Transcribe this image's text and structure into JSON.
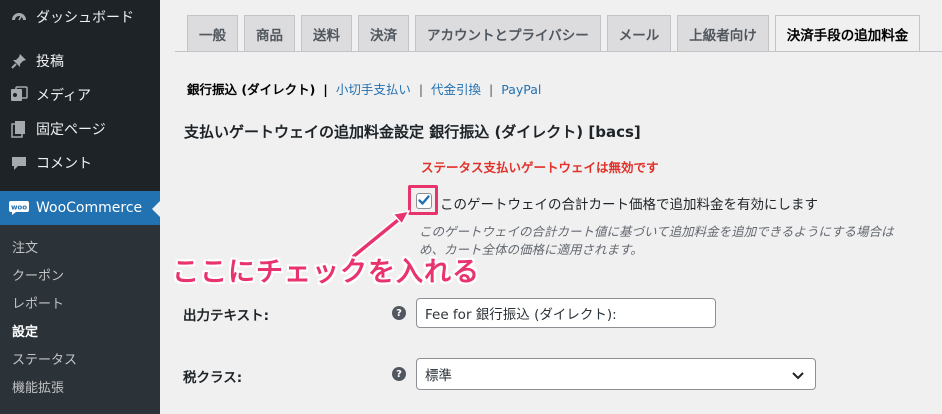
{
  "sidebar": {
    "items": [
      {
        "label": "ダッシュボード",
        "icon": "dashboard-icon"
      },
      {
        "label": "投稿",
        "icon": "pin-icon"
      },
      {
        "label": "メディア",
        "icon": "media-icon"
      },
      {
        "label": "固定ページ",
        "icon": "page-icon"
      },
      {
        "label": "コメント",
        "icon": "comment-icon"
      },
      {
        "label": "WooCommerce",
        "icon": "woo-icon"
      }
    ],
    "submenu": [
      {
        "label": "注文"
      },
      {
        "label": "クーポン"
      },
      {
        "label": "レポート"
      },
      {
        "label": "設定"
      },
      {
        "label": "ステータス"
      },
      {
        "label": "機能拡張"
      }
    ]
  },
  "tabs": [
    {
      "label": "一般"
    },
    {
      "label": "商品"
    },
    {
      "label": "送料"
    },
    {
      "label": "決済"
    },
    {
      "label": "アカウントとプライバシー"
    },
    {
      "label": "メール"
    },
    {
      "label": "上級者向け"
    },
    {
      "label": "決済手段の追加料金"
    }
  ],
  "subnav": {
    "current": "銀行振込 (ダイレクト)",
    "links": [
      "小切手支払い",
      "代金引換",
      "PayPal"
    ],
    "separator": "|"
  },
  "section_title": "支払いゲートウェイの追加料金設定 銀行振込 (ダイレクト) [bacs]",
  "gateway_status": "ステータス支払いゲートウェイは無効です",
  "enable_fee": {
    "checked": true,
    "label": "このゲートウェイの合計カート価格で追加料金を有効にします",
    "description_1": "このゲートウェイの合計カート値に基づいて追加料金を追加できるようにする場合は",
    "description_2": "め、カート全体の価格に適用されます。"
  },
  "annotation": "ここにチェックを入れる",
  "output_text": {
    "label": "出力テキスト:",
    "value": "Fee for 銀行振込 (ダイレクト):"
  },
  "tax_class": {
    "label": "税クラス:",
    "selected": "標準"
  },
  "help_glyph": "?",
  "colors": {
    "sidebar_bg": "#1d2327",
    "submenu_bg": "#2c3338",
    "accent": "#2271b1",
    "warning": "#e0312b",
    "annotation": "#e8336d"
  }
}
